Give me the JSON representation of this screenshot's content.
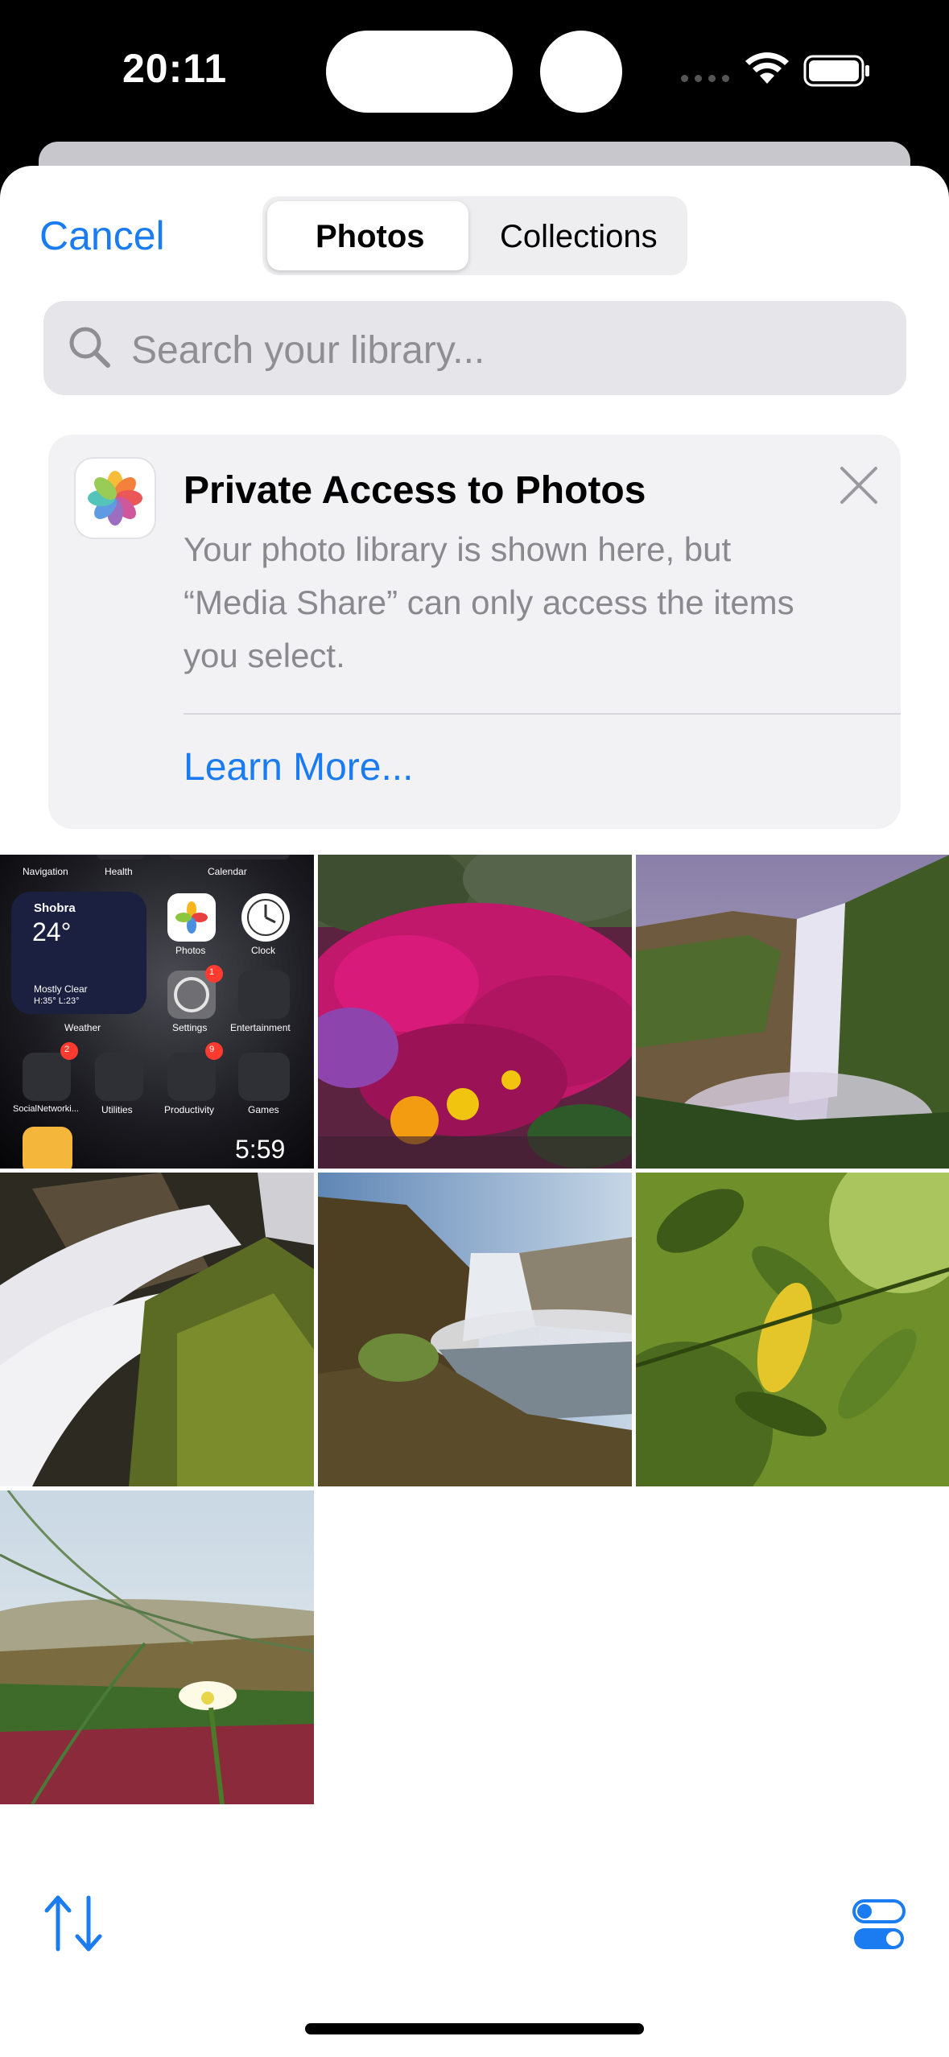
{
  "status_bar": {
    "time": "20:11"
  },
  "header": {
    "cancel_label": "Cancel",
    "tabs": [
      {
        "label": "Photos",
        "selected": true
      },
      {
        "label": "Collections",
        "selected": false
      }
    ]
  },
  "search": {
    "placeholder": "Search your library..."
  },
  "banner": {
    "title": "Private Access to Photos",
    "body": "Your photo library is shown here, but “Media Share” can only access the items you select.",
    "link": "Learn More..."
  },
  "photos": [
    {
      "kind": "screenshot-home-screen",
      "labels": {
        "navigation": "Navigation",
        "health": "Health",
        "calendar": "Calendar",
        "weather_city": "Shobra",
        "weather_temp": "24°",
        "weather_cond": "Mostly Clear",
        "weather_range": "H:35° L:23°",
        "weather_label": "Weather",
        "photos": "Photos",
        "clock": "Clock",
        "settings": "Settings",
        "entertainment": "Entertainment",
        "social": "SocialNetworki...",
        "utilities": "Utilities",
        "productivity": "Productivity",
        "games": "Games",
        "video_time": "5:59",
        "badge_settings": "1",
        "badge_social": "2",
        "badge_productivity": "9"
      }
    },
    {
      "kind": "pink-flowers"
    },
    {
      "kind": "waterfall-cliff"
    },
    {
      "kind": "waterfall-rocks"
    },
    {
      "kind": "waterfall-river"
    },
    {
      "kind": "green-leaves"
    },
    {
      "kind": "white-flower-grass"
    }
  ],
  "colors": {
    "accent": "#1a7cf0",
    "background": "#ffffff",
    "banner_bg": "#f2f2f4"
  }
}
